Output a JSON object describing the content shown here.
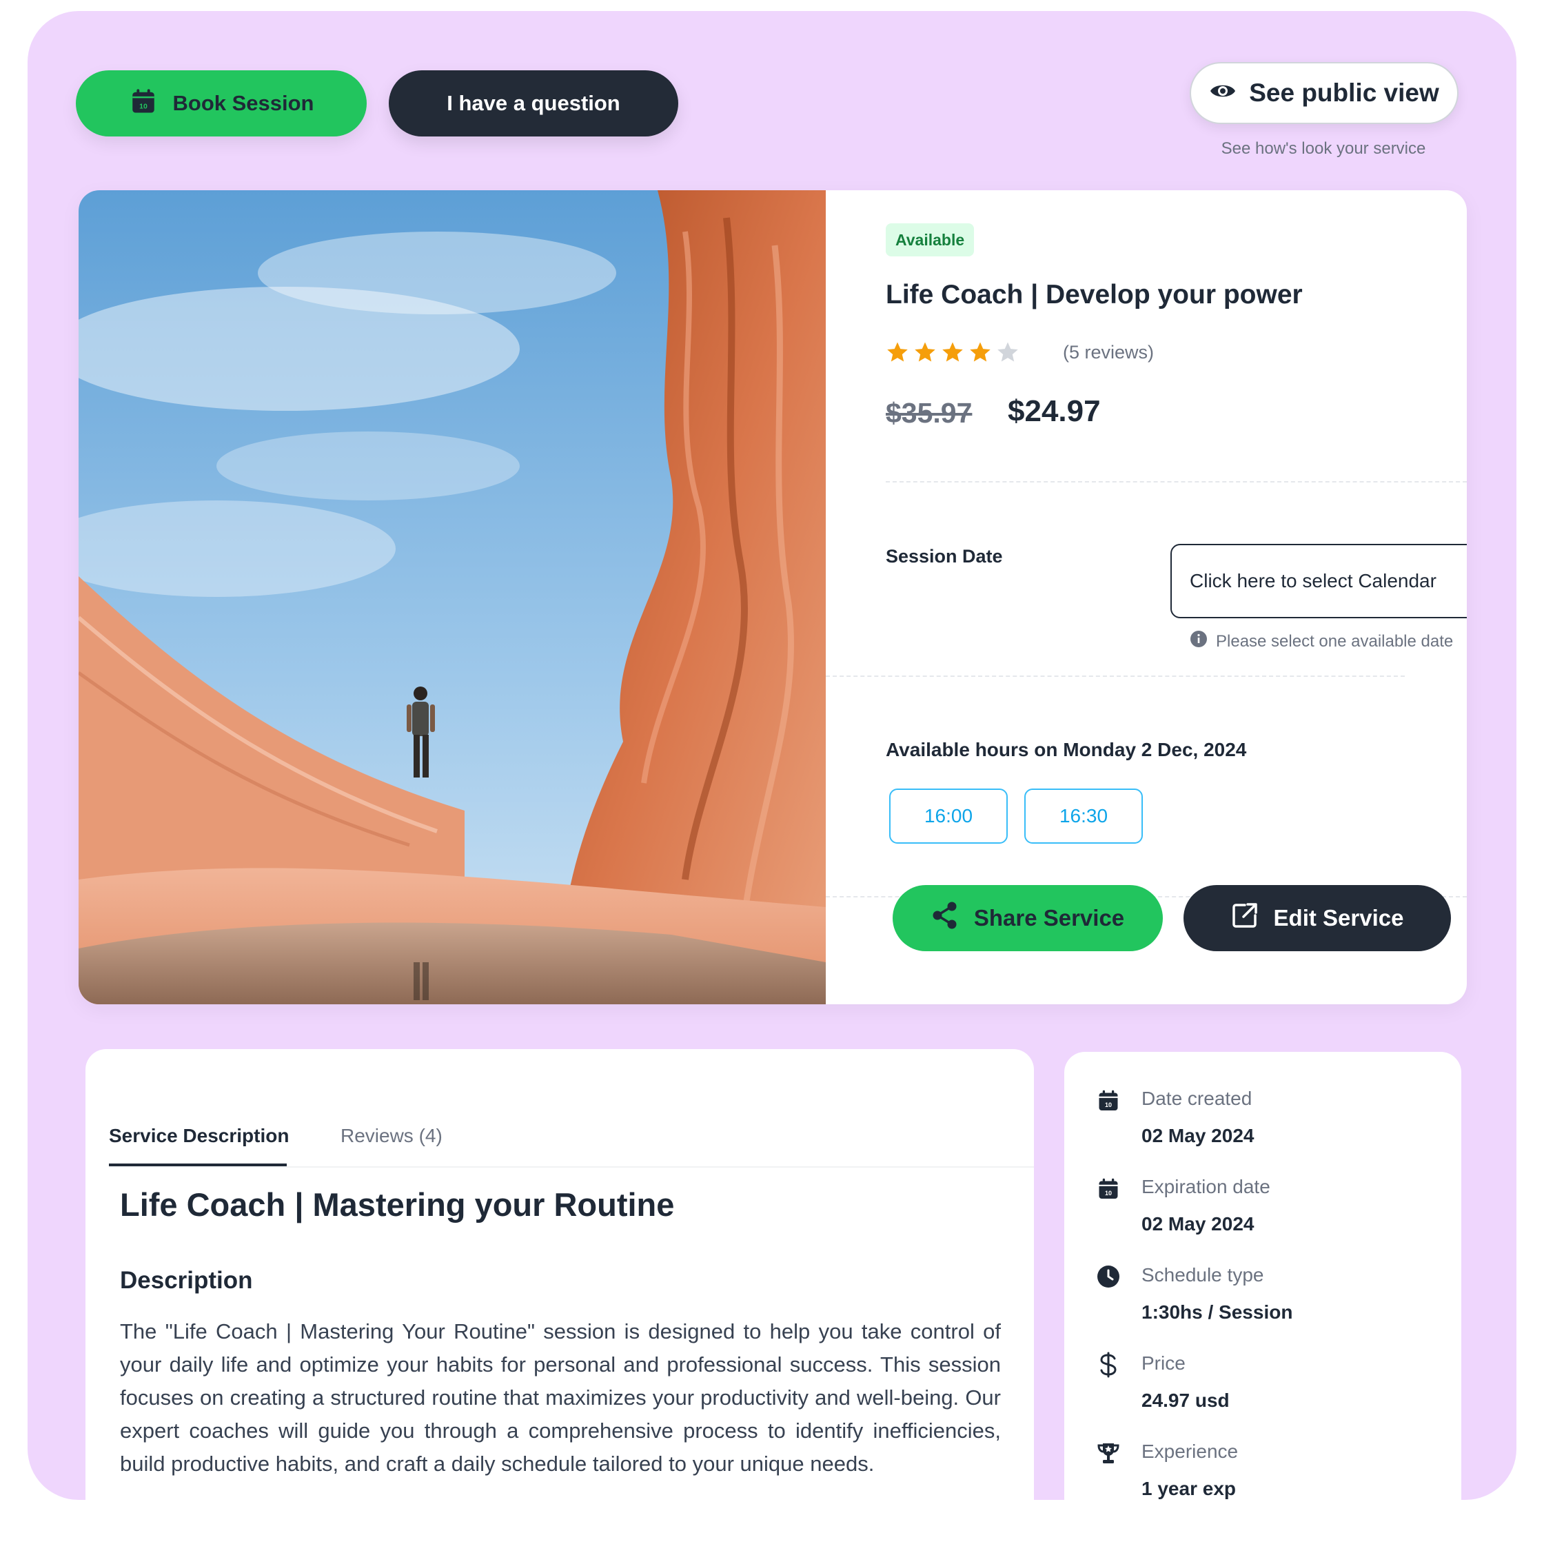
{
  "actions": {
    "book_label": "Book Session",
    "question_label": "I have a question",
    "public_view_label": "See public view",
    "public_view_hint": "See how's look your service"
  },
  "service": {
    "status": "Available",
    "title": "Life Coach | Develop your power",
    "rating": 4,
    "rating_max": 5,
    "reviews_text": "(5 reviews)",
    "price_old": "$35.97",
    "price_new": "$24.97",
    "session_date_label": "Session Date",
    "calendar_placeholder": "Click here to select Calendar",
    "calendar_hint": "Please select one available date",
    "hours_label": "Available hours on Monday 2 Dec, 2024",
    "slots": [
      "16:00",
      "16:30"
    ],
    "share_label": "Share Service",
    "edit_label": "Edit Service"
  },
  "tabs": [
    {
      "label": "Service Description",
      "active": true
    },
    {
      "label": "Reviews (4)",
      "active": false
    }
  ],
  "description": {
    "title": "Life Coach | Mastering your Routine",
    "subtitle": "Description",
    "body": "The \"Life Coach | Mastering Your Routine\" session is designed to help you take control of your daily life and optimize your habits for personal and professional success. This session focuses on creating a structured routine that maximizes your productivity and well-being. Our expert coaches will guide you through a comprehensive process to identify inefficiencies, build productive habits, and craft a daily schedule tailored to your unique needs."
  },
  "meta": [
    {
      "icon": "calendar-icon",
      "label": "Date created",
      "value": "02 May 2024"
    },
    {
      "icon": "calendar-icon",
      "label": "Expiration date",
      "value": "02 May 2024"
    },
    {
      "icon": "clock-icon",
      "label": "Schedule type",
      "value": "1:30hs / Session"
    },
    {
      "icon": "dollar-icon",
      "label": "Price",
      "value": "24.97 usd"
    },
    {
      "icon": "trophy-icon",
      "label": "Experience",
      "value": "1 year exp"
    }
  ],
  "colors": {
    "background": "#efd6fd",
    "accent_green": "#22c55e",
    "dark": "#232b37",
    "star": "#f59e0b",
    "slot_blue": "#0ea5e9"
  }
}
